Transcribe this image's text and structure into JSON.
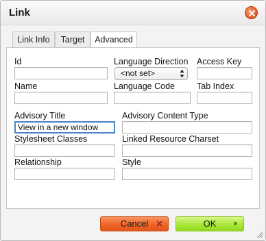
{
  "dialog": {
    "title": "Link"
  },
  "tabs": [
    {
      "label": "Link Info"
    },
    {
      "label": "Target"
    },
    {
      "label": "Advanced"
    }
  ],
  "fields": {
    "id": {
      "label": "Id",
      "value": ""
    },
    "language_direction": {
      "label": "Language Direction",
      "value": "<not set>"
    },
    "access_key": {
      "label": "Access Key",
      "value": ""
    },
    "name": {
      "label": "Name",
      "value": ""
    },
    "language_code": {
      "label": "Language Code",
      "value": ""
    },
    "tab_index": {
      "label": "Tab Index",
      "value": ""
    },
    "advisory_title": {
      "label": "Advisory Title",
      "value": "View in a new window"
    },
    "advisory_content_type": {
      "label": "Advisory Content Type",
      "value": ""
    },
    "stylesheet_classes": {
      "label": "Stylesheet Classes",
      "value": ""
    },
    "linked_resource_charset": {
      "label": "Linked Resource Charset",
      "value": ""
    },
    "relationship": {
      "label": "Relationship",
      "value": ""
    },
    "style": {
      "label": "Style",
      "value": ""
    }
  },
  "buttons": {
    "cancel": "Cancel",
    "ok": "OK"
  },
  "colors": {
    "cancel": "#ee6328",
    "ok": "#a9e63a",
    "close": "#e4602a",
    "focus": "#4a86c7"
  },
  "icons": {
    "close": "close-icon",
    "cancel": "x-icon",
    "ok": "arrow-right-icon",
    "select": "updown-arrows-icon",
    "resize": "resize-grip-icon"
  }
}
